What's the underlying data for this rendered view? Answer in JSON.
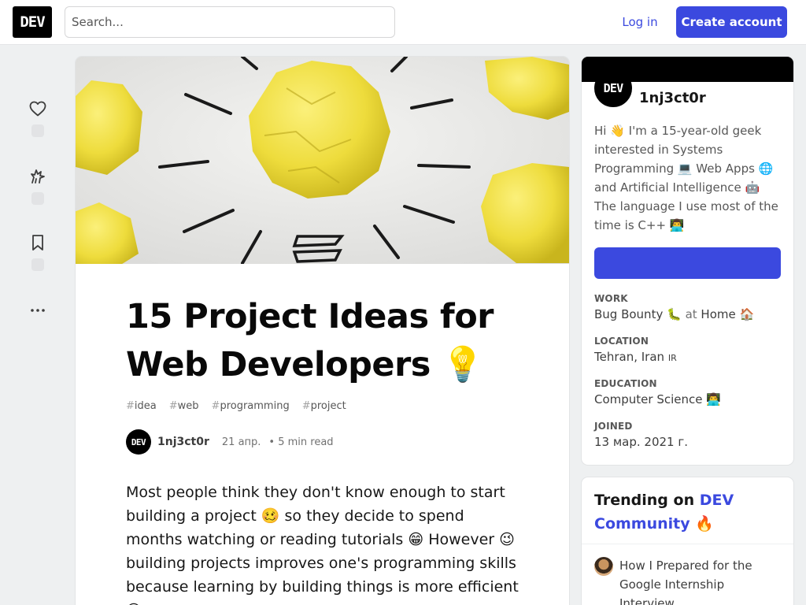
{
  "header": {
    "logo": "DEV",
    "search_placeholder": "Search...",
    "login_label": "Log in",
    "create_account_label": "Create account"
  },
  "article": {
    "title": "15 Project Ideas for Web Developers 💡",
    "tags": [
      {
        "hash": "#",
        "name": "idea"
      },
      {
        "hash": "#",
        "name": "web"
      },
      {
        "hash": "#",
        "name": "programming"
      },
      {
        "hash": "#",
        "name": "project"
      }
    ],
    "author_avatar": "DEV",
    "author": "1nj3ct0r",
    "date": "21 апр.",
    "read_time": "• 5 min read",
    "body": "Most people think they don't know enough to start building a project 🥴 so they decide to spend months watching or reading tutorials 😁 However 😉 building projects improves one's programming skills because learning by building things is more efficient 😄"
  },
  "profile": {
    "avatar": "DEV",
    "name": "1nj3ct0r",
    "bio": "Hi 👋 I'm a 15-year-old geek interested in Systems Programming 💻 Web Apps 🌐 and Artificial Intelligence 🤖 The language I use most of the time is C++ 👨‍💻",
    "work_label": "WORK",
    "work_value": "Bug Bounty 🐛",
    "work_at": "at",
    "work_place": "Home 🏠",
    "location_label": "LOCATION",
    "location_value": "Tehran, Iran",
    "location_flag": "IR",
    "education_label": "EDUCATION",
    "education_value": "Computer Science 👨‍💻",
    "joined_label": "JOINED",
    "joined_value": "13 мар. 2021 г."
  },
  "trending": {
    "title_prefix": "Trending on",
    "title_accent": "DEV Community",
    "title_emoji": "🔥",
    "items": [
      "How I Prepared for the Google Internship Interview."
    ]
  },
  "colors": {
    "accent": "#3b49df",
    "page_bg": "#eef0f1",
    "cover_yellow": "#f3e250"
  },
  "icons": {
    "heart": "heart-icon",
    "unicorn": "unicorn-icon",
    "bookmark": "bookmark-icon",
    "more": "more-icon"
  }
}
